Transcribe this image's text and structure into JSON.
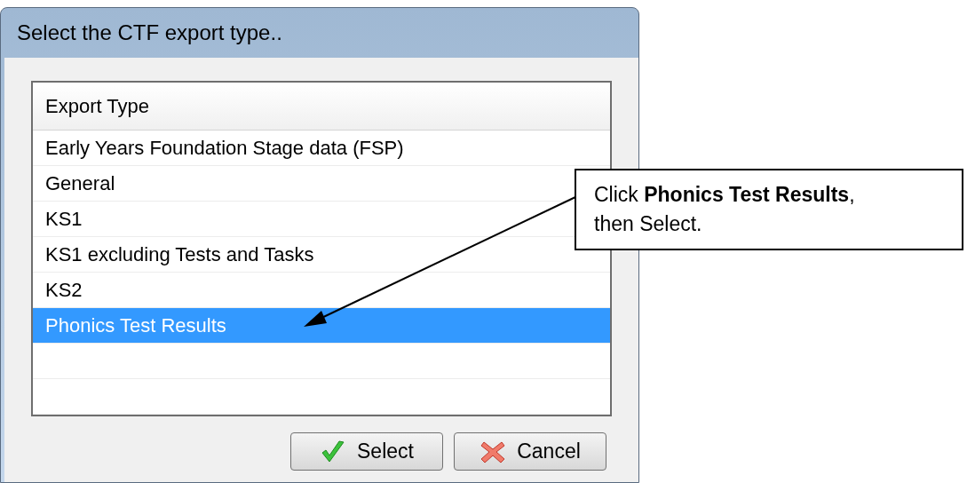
{
  "window": {
    "title": "Select the CTF export type.."
  },
  "list": {
    "columns": [
      "Export Type"
    ],
    "rows": [
      {
        "label": "Early Years Foundation Stage data (FSP)",
        "selected": false
      },
      {
        "label": "General",
        "selected": false
      },
      {
        "label": "KS1",
        "selected": false
      },
      {
        "label": "KS1 excluding Tests and Tasks",
        "selected": false
      },
      {
        "label": "KS2",
        "selected": false
      },
      {
        "label": "Phonics Test Results",
        "selected": true
      }
    ]
  },
  "buttons": [
    {
      "kind": "ok",
      "label": "Select"
    },
    {
      "kind": "cancel",
      "label": "Cancel"
    }
  ],
  "callout": {
    "text": "Click **Phonics Test Results**,\nthen Select."
  }
}
